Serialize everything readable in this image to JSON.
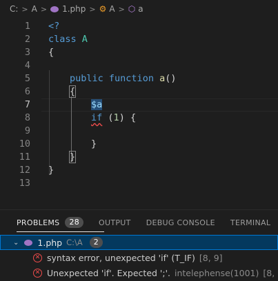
{
  "breadcrumb": {
    "drive": "C:",
    "folder": "A",
    "file": "1.php",
    "class_symbol": "A",
    "method_symbol": "a"
  },
  "editor": {
    "active_line": 7,
    "lines": [
      {
        "n": "1"
      },
      {
        "n": "2"
      },
      {
        "n": "3"
      },
      {
        "n": "4"
      },
      {
        "n": "5"
      },
      {
        "n": "6"
      },
      {
        "n": "7"
      },
      {
        "n": "8"
      },
      {
        "n": "9"
      },
      {
        "n": "10"
      },
      {
        "n": "11"
      },
      {
        "n": "12"
      },
      {
        "n": "13"
      }
    ],
    "tokens": {
      "open_tag": "<?",
      "class_kw": "class",
      "class_name": "A",
      "brace_open": "{",
      "public_kw": "public",
      "function_kw": "function",
      "method_name": "a",
      "parens": "()",
      "method_brace_open": "{",
      "var": "$a",
      "if_kw": "if",
      "if_paren_open": "(",
      "if_num": "1",
      "if_paren_close": ")",
      "if_brace": "{",
      "inner_brace_close": "}",
      "method_brace_close": "}",
      "class_brace_close": "}"
    }
  },
  "panel": {
    "tabs": [
      {
        "label": "PROBLEMS",
        "badge": "28"
      },
      {
        "label": "OUTPUT"
      },
      {
        "label": "DEBUG CONSOLE"
      },
      {
        "label": "TERMINAL"
      }
    ],
    "file": {
      "name": "1.php",
      "path": "C:\\A",
      "count": "2"
    },
    "problems": [
      {
        "message": "syntax error, unexpected 'if' (T_IF)",
        "source": "",
        "position": "[8, 9]"
      },
      {
        "message": "Unexpected 'if'. Expected ';'.",
        "source": "intelephense(1001)",
        "position": "[8, 9]"
      }
    ]
  },
  "colors": {
    "background": "#1e1e1e",
    "keyword": "#569cd6",
    "class": "#4ec9b0",
    "function": "#dcdcaa",
    "variable": "#9cdcfe",
    "number": "#b5cea8",
    "error": "#f14c4c",
    "selection_border": "#0078d4"
  },
  "icons": {
    "php_file": "php-elephant-icon",
    "class_symbol": "symbol-class-icon",
    "method_symbol": "symbol-method-icon",
    "error": "error-circle-icon",
    "chevron": "chevron-down-icon"
  }
}
